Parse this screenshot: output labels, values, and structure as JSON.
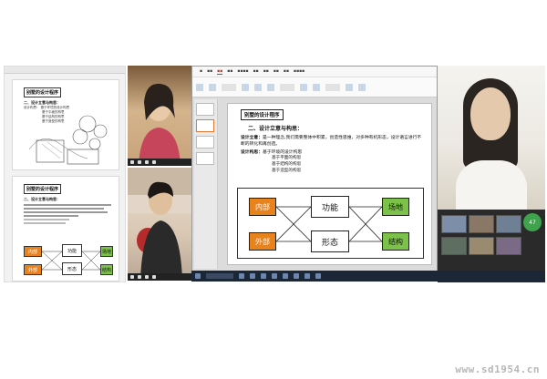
{
  "slide": {
    "title": "别墅的设计程序",
    "section": "二、设计立意与构思：",
    "para_label": "设计立意：",
    "para_text": "是一种理念,我们需要整体中积累，创造性思维，对多种有机形态，设计语言进行不断的转化和再创造。",
    "construct_label": "设计构思：",
    "construct_items": [
      "基于环境的设计构思",
      "基于平面的构思",
      "基于结构的构思",
      "基于造型的构思"
    ]
  },
  "diagram": {
    "left_top": "内部",
    "left_bottom": "外部",
    "center_top": "功能",
    "center_bottom": "形态",
    "right_top": "场地",
    "right_bottom": "结构",
    "colors": {
      "orange": "#e8821d",
      "green": "#7cc24a"
    }
  },
  "left_doc": {
    "page1_title": "别墅的设计程序",
    "page1_sub": "二、设计立意与构思：",
    "page1_lines": [
      "设计构思：  基于环境的设计构思",
      "基于平面的构思",
      "基于结构的构思",
      "基于造型的构思"
    ],
    "page2_title": "别墅的设计程序",
    "page2_sub": "二、设计立意与构思：",
    "mini_left_top": "内部",
    "mini_left_bottom": "外部",
    "mini_center_top": "功能",
    "mini_center_bottom": "形态",
    "mini_right_top": "场地",
    "mini_right_bottom": "结构"
  },
  "right_panel": {
    "badge": "47"
  },
  "watermark": "www.sd1954.cn"
}
